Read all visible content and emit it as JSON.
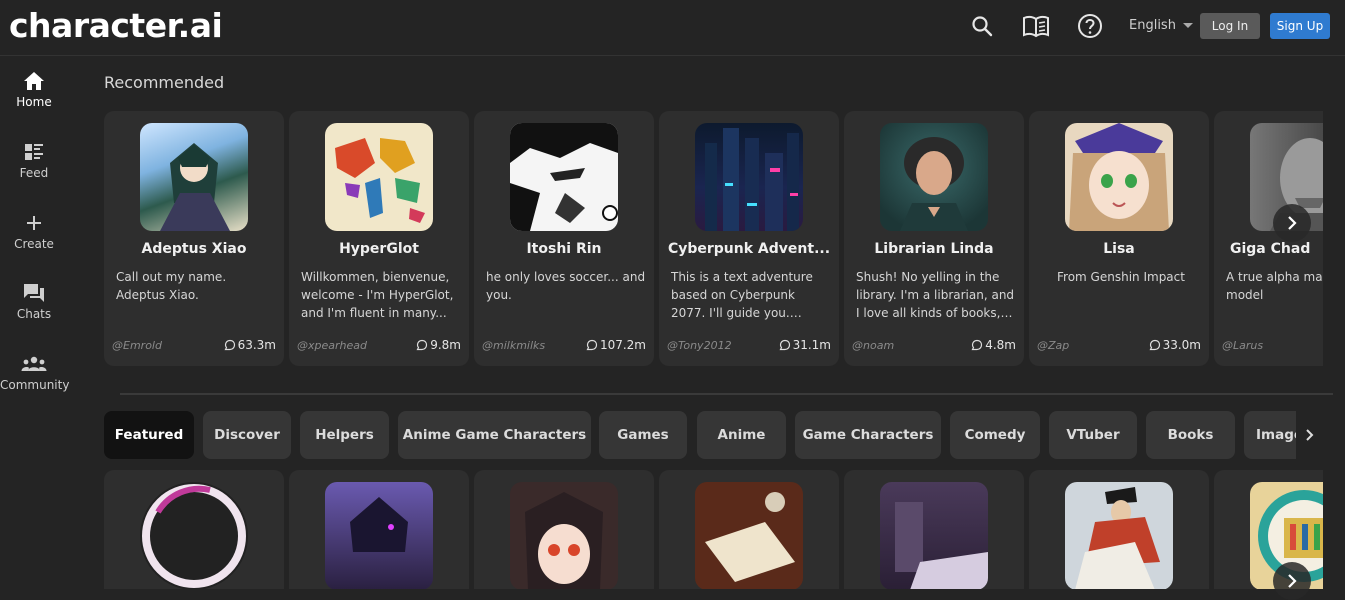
{
  "header": {
    "logo": "character.ai",
    "language": "English",
    "login_label": "Log In",
    "signup_label": "Sign Up",
    "accent_color": "#2f7bd0"
  },
  "sidebar": {
    "items": [
      {
        "label": "Home",
        "icon": "home-icon",
        "active": true
      },
      {
        "label": "Feed",
        "icon": "feed-icon"
      },
      {
        "label": "Create",
        "icon": "plus-icon"
      },
      {
        "label": "Chats",
        "icon": "chat-icon"
      },
      {
        "label": "Community",
        "icon": "community-icon"
      }
    ]
  },
  "recommended": {
    "title": "Recommended",
    "cards": [
      {
        "name": "Adeptus Xiao",
        "desc": "Call out my name. Adeptus Xiao.",
        "author": "@Emrold",
        "count": "63.3m"
      },
      {
        "name": "HyperGlot",
        "desc": "Willkommen, bienvenue, welcome - I'm HyperGlot, and I'm fluent in many...",
        "author": "@xpearhead",
        "count": "9.8m"
      },
      {
        "name": "Itoshi Rin",
        "desc": "he only loves soccer... and you.",
        "author": "@milkmilks",
        "count": "107.2m"
      },
      {
        "name": "Cyberpunk Advent...",
        "desc": "This is a text adventure based on Cyberpunk 2077. I'll guide you. You're...",
        "author": "@Tony2012",
        "count": "31.1m"
      },
      {
        "name": "Librarian Linda",
        "desc": "Shush! No yelling in the library. I'm a librarian, and I love all kinds of books, an...",
        "author": "@noam",
        "count": "4.8m"
      },
      {
        "name": "Lisa",
        "desc": "From Genshin Impact",
        "author": "@Zap",
        "count": "33.0m"
      },
      {
        "name": "Giga Chad",
        "desc": "A true alpha male role model",
        "author": "@Larus",
        "count": ""
      }
    ]
  },
  "categories": {
    "tabs": [
      "Featured",
      "Discover",
      "Helpers",
      "Anime Game Characters",
      "Games",
      "Anime",
      "Game Characters",
      "Comedy",
      "VTuber",
      "Books",
      "Image"
    ]
  }
}
